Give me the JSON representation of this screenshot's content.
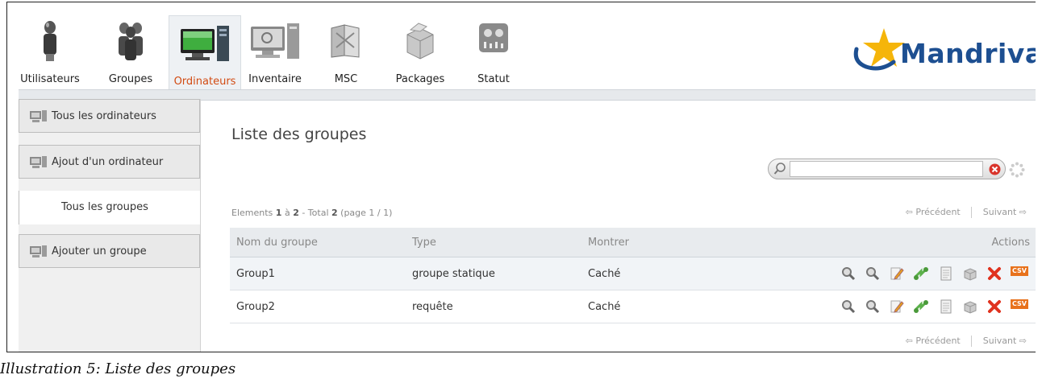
{
  "nav": {
    "items": [
      {
        "label": "Utilisateurs",
        "icon": "user-icon"
      },
      {
        "label": "Groupes",
        "icon": "users-group-icon"
      },
      {
        "label": "Ordinateurs",
        "icon": "computer-icon",
        "active": true
      },
      {
        "label": "Inventaire",
        "icon": "inventory-icon"
      },
      {
        "label": "MSC",
        "icon": "msc-icon"
      },
      {
        "label": "Packages",
        "icon": "package-icon"
      },
      {
        "label": "Statut",
        "icon": "status-icon"
      }
    ],
    "active_color": "#d24b12"
  },
  "brand": {
    "logo_text": "Mandriva",
    "color": "#1d4f91"
  },
  "sidebar": {
    "items": [
      {
        "label": "Tous les ordinateurs"
      },
      {
        "label": "Ajout d'un ordinateur"
      },
      {
        "label": "Tous les groupes",
        "selected": true
      },
      {
        "label": "Ajouter un groupe"
      }
    ]
  },
  "main": {
    "title": "Liste des groupes",
    "search": {
      "value": "",
      "placeholder": ""
    },
    "pager": {
      "info_prefix": "Elements",
      "info_from": "1",
      "info_to_word": "à",
      "info_to": "2",
      "info_total_label": "- Total",
      "info_total": "2",
      "info_page": "(page 1 / 1)",
      "prev": "Précédent",
      "next": "Suivant"
    },
    "table": {
      "columns": [
        "Nom du groupe",
        "Type",
        "Montrer",
        "Actions"
      ],
      "rows": [
        {
          "name": "Group1",
          "type": "groupe statique",
          "show": "Caché"
        },
        {
          "name": "Group2",
          "type": "requête",
          "show": "Caché"
        }
      ],
      "actions": [
        "view-icon",
        "zoom-icon",
        "edit-icon",
        "share-icon",
        "document-icon",
        "package-icon",
        "delete-icon",
        "csv-export"
      ],
      "csv_label": "CSV"
    }
  },
  "caption": "Illustration 5: Liste des groupes"
}
